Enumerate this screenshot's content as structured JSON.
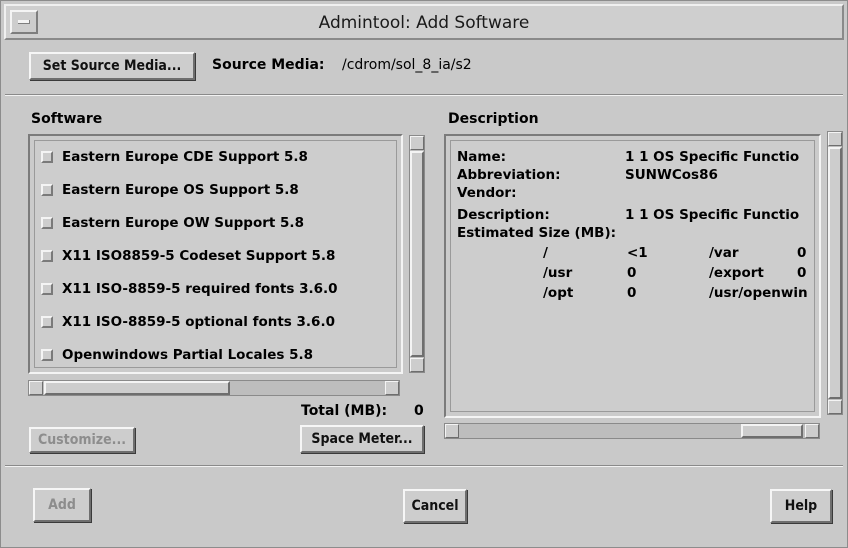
{
  "window": {
    "title": "Admintool: Add Software"
  },
  "source": {
    "set_button": "Set Source Media...",
    "label": "Source Media:",
    "value": "/cdrom/sol_8_ia/s2"
  },
  "software": {
    "heading": "Software",
    "items": [
      {
        "label": "Eastern Europe CDE Support 5.8",
        "checked": false
      },
      {
        "label": "Eastern Europe OS Support 5.8",
        "checked": false
      },
      {
        "label": "Eastern Europe OW Support 5.8",
        "checked": false
      },
      {
        "label": "X11 ISO8859-5 Codeset Support 5.8",
        "checked": false
      },
      {
        "label": "X11 ISO-8859-5 required fonts 3.6.0",
        "checked": false
      },
      {
        "label": "X11 ISO-8859-5 optional fonts 3.6.0",
        "checked": false
      },
      {
        "label": "Openwindows Partial Locales 5.8",
        "checked": false
      }
    ],
    "total_label": "Total (MB):",
    "total_value": "0",
    "customize_button": "Customize...",
    "space_meter_button": "Space Meter..."
  },
  "description": {
    "heading": "Description",
    "name_label": "Name:",
    "name_value": "1 1 OS Specific Functio",
    "abbrev_label": "Abbreviation:",
    "abbrev_value": "SUNWCos86",
    "vendor_label": "Vendor:",
    "vendor_value": "",
    "desc_label": "Description:",
    "desc_value": "1 1 OS Specific Functio",
    "size_label": "Estimated Size (MB):",
    "sizes": [
      {
        "dir1": "/",
        "val1": "<1",
        "dir2": "/var",
        "val2": "0"
      },
      {
        "dir1": "/usr",
        "val1": "0",
        "dir2": "/export",
        "val2": "0"
      },
      {
        "dir1": "/opt",
        "val1": "0",
        "dir2": "/usr/openwin",
        "val2": ""
      }
    ]
  },
  "footer": {
    "add_button": "Add",
    "cancel_button": "Cancel",
    "help_button": "Help"
  }
}
